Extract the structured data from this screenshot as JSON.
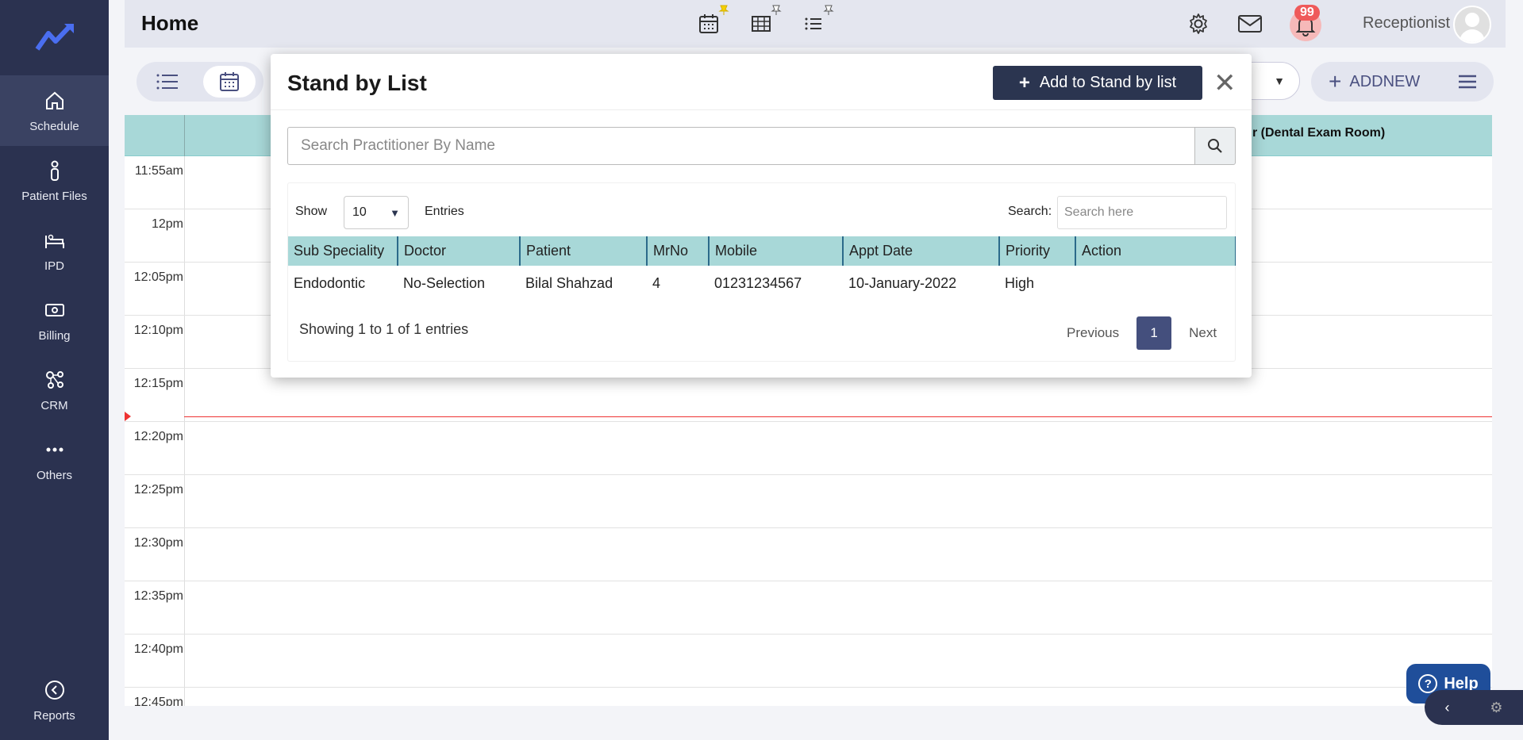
{
  "page": {
    "title": "Home"
  },
  "sidebar": {
    "items": [
      {
        "label": "Schedule",
        "icon": "home-icon"
      },
      {
        "label": "Patient Files",
        "icon": "person-icon"
      },
      {
        "label": "IPD",
        "icon": "bed-icon"
      },
      {
        "label": "Billing",
        "icon": "money-icon"
      },
      {
        "label": "CRM",
        "icon": "network-icon"
      },
      {
        "label": "Others",
        "icon": "dots-icon"
      }
    ],
    "bottom": {
      "label": "Reports",
      "icon": "chart-icon"
    }
  },
  "topbar": {
    "notification_count": "99",
    "user_label": "Receptionist"
  },
  "toolbar": {
    "addnew_label": "ADDNEW"
  },
  "schedule": {
    "room_label": "r (Dental Exam Room)",
    "times": [
      "11:55am",
      "12pm",
      "12:05pm",
      "12:10pm",
      "12:15pm",
      "12:20pm",
      "12:25pm",
      "12:30pm",
      "12:35pm",
      "12:40pm",
      "12:45pm"
    ]
  },
  "modal": {
    "title": "Stand by List",
    "add_button": "Add to Stand by list",
    "practitioner_search_placeholder": "Search Practitioner By Name",
    "show_label": "Show",
    "entries_value": "10",
    "entries_label": "Entries",
    "search_label": "Search:",
    "search_placeholder": "Search here",
    "columns": [
      "Sub Speciality",
      "Doctor",
      "Patient",
      "MrNo",
      "Mobile",
      "Appt Date",
      "Priority",
      "Action"
    ],
    "rows": [
      [
        "Endodontic",
        "No-Selection",
        "Bilal Shahzad",
        "4",
        "01231234567",
        "10-January-2022",
        "High",
        ""
      ]
    ],
    "showing_text": "Showing 1 to 1 of 1 entries",
    "pager": {
      "previous": "Previous",
      "current": "1",
      "next": "Next"
    }
  },
  "help": {
    "label": "Help"
  },
  "colors": {
    "sidebar_bg": "#2b3250",
    "table_header_bg": "#a8d8d8",
    "accent": "#444f7d",
    "now_line": "#e33333"
  }
}
